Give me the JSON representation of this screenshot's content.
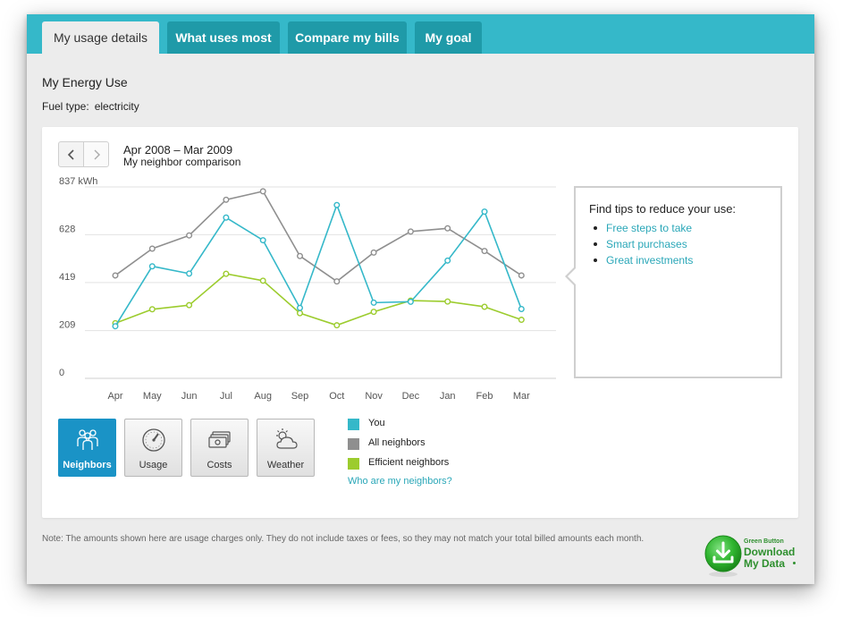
{
  "tabs": [
    {
      "label": "My usage details",
      "active": true
    },
    {
      "label": "What uses most",
      "active": false
    },
    {
      "label": "Compare my bills",
      "active": false
    },
    {
      "label": "My goal",
      "active": false
    }
  ],
  "page": {
    "title": "My Energy Use",
    "fuel_label": "Fuel type:",
    "fuel_value": "electricity"
  },
  "period": {
    "prev_icon": "chevron-left-icon",
    "next_icon": "chevron-right-icon",
    "range": "Apr 2008 – Mar 2009",
    "subtitle": "My neighbor comparison"
  },
  "chart_data": {
    "type": "line",
    "categories": [
      "Apr",
      "May",
      "Jun",
      "Jul",
      "Aug",
      "Sep",
      "Oct",
      "Nov",
      "Dec",
      "Jan",
      "Feb",
      "Mar"
    ],
    "y_tick_labels": [
      "0",
      "209",
      "419",
      "628",
      "837 kWh"
    ],
    "y_ticks": [
      0,
      209,
      419,
      628,
      837
    ],
    "ylim": [
      0,
      837
    ],
    "grid": true,
    "series": [
      {
        "name": "You",
        "color": "#35b8c9",
        "values": [
          228,
          490,
          458,
          703,
          604,
          308,
          758,
          331,
          335,
          515,
          729,
          303
        ]
      },
      {
        "name": "All neighbors",
        "color": "#8f8f8f",
        "values": [
          450,
          567,
          625,
          781,
          818,
          535,
          424,
          550,
          642,
          656,
          557,
          450
        ]
      },
      {
        "name": "Efficient neighbors",
        "color": "#9ccc2e",
        "values": [
          241,
          302,
          320,
          457,
          427,
          285,
          232,
          291,
          340,
          336,
          313,
          256
        ]
      }
    ]
  },
  "tips": {
    "title": "Find tips to reduce your use:",
    "items": [
      "Free steps to take",
      "Smart purchases",
      "Great investments"
    ]
  },
  "modes": [
    {
      "label": "Neighbors",
      "icon": "people-icon",
      "active": true
    },
    {
      "label": "Usage",
      "icon": "gauge-icon",
      "active": false
    },
    {
      "label": "Costs",
      "icon": "money-icon",
      "active": false
    },
    {
      "label": "Weather",
      "icon": "weather-icon",
      "active": false
    }
  ],
  "legend": {
    "items": [
      {
        "label": "You",
        "color": "#35b8c9"
      },
      {
        "label": "All neighbors",
        "color": "#8f8f8f"
      },
      {
        "label": "Efficient neighbors",
        "color": "#9ccc2e"
      }
    ],
    "link": "Who are my neighbors?"
  },
  "note": "Note: The amounts shown here are usage charges only. They do not include taxes or fees, so they may not match your total billed amounts each month.",
  "green_button": {
    "small": "Green Button",
    "line1": "Download",
    "line2": "My Data",
    "icon": "download-icon"
  }
}
